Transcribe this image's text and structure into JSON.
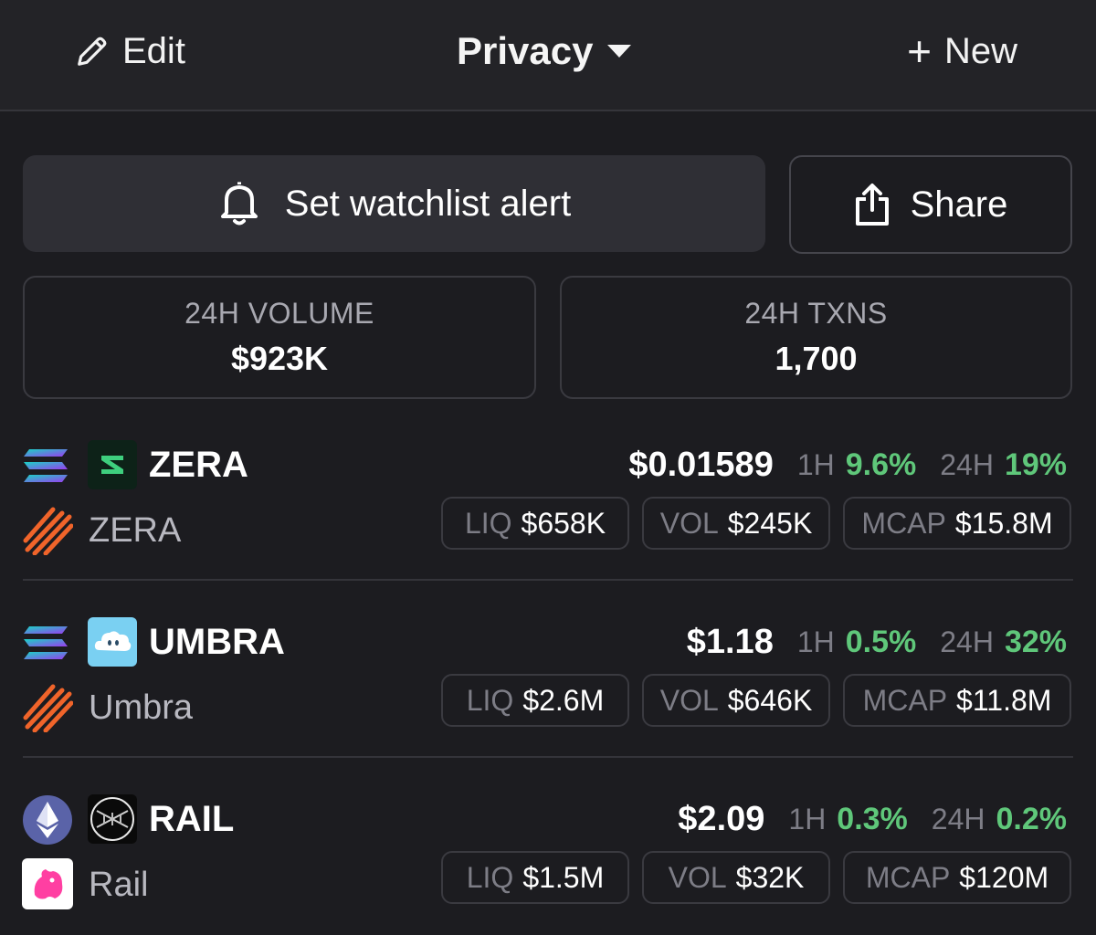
{
  "header": {
    "edit_label": "Edit",
    "title": "Privacy",
    "new_label": "New"
  },
  "actions": {
    "alert_label": "Set watchlist alert",
    "share_label": "Share"
  },
  "stats": {
    "volume_label": "24H VOLUME",
    "volume_value": "$923K",
    "txns_label": "24H TXNS",
    "txns_value": "1,700"
  },
  "labels": {
    "h1": "1H",
    "h24": "24H",
    "liq": "LIQ",
    "vol": "VOL",
    "mcap": "MCAP"
  },
  "colors": {
    "positive": "#5fc77a",
    "background": "#1c1c20"
  },
  "tokens": [
    {
      "symbol": "ZERA",
      "name": "ZERA",
      "chain_icon": "solana-icon",
      "dex_icon": "raydium-icon",
      "price": "$0.01589",
      "change_1h": "9.6%",
      "change_24h": "19%",
      "liq": "$658K",
      "vol": "$245K",
      "mcap": "$15.8M"
    },
    {
      "symbol": "UMBRA",
      "name": "Umbra",
      "chain_icon": "solana-icon",
      "dex_icon": "raydium-icon",
      "price": "$1.18",
      "change_1h": "0.5%",
      "change_24h": "32%",
      "liq": "$2.6M",
      "vol": "$646K",
      "mcap": "$11.8M"
    },
    {
      "symbol": "RAIL",
      "name": "Rail",
      "chain_icon": "ethereum-icon",
      "dex_icon": "uniswap-icon",
      "price": "$2.09",
      "change_1h": "0.3%",
      "change_24h": "0.2%",
      "liq": "$1.5M",
      "vol": "$32K",
      "mcap": "$120M"
    }
  ]
}
